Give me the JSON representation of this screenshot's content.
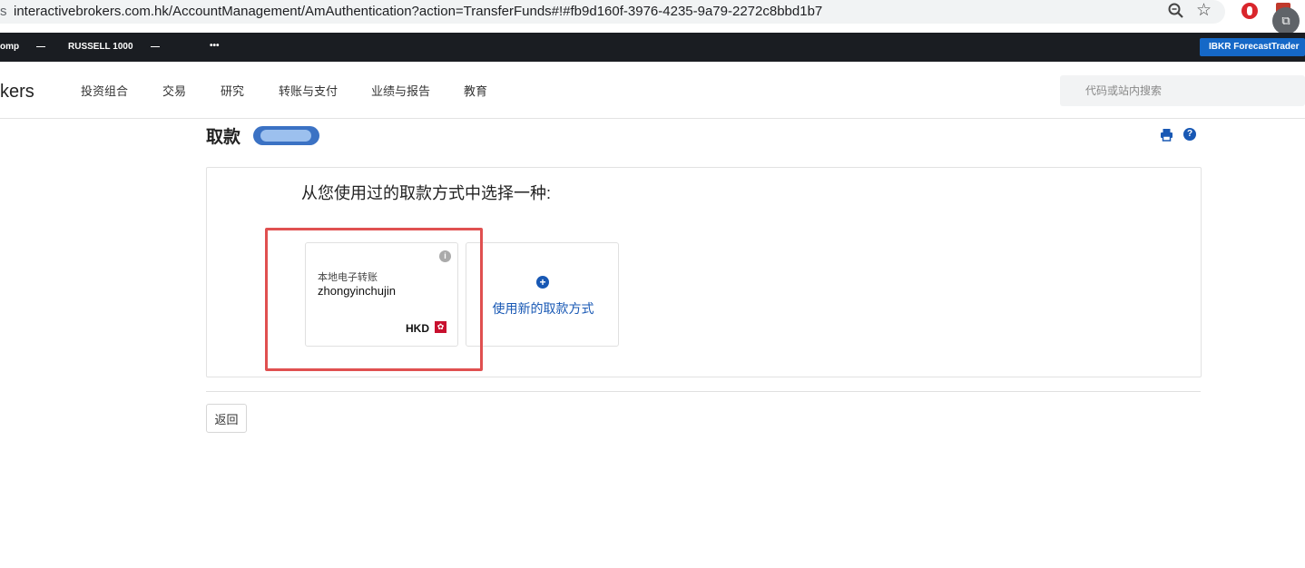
{
  "browser": {
    "url": "interactivebrokers.com.hk/AccountManagement/AmAuthentication?action=TransferFunds#!#fb9d160f-3976-4235-9a79-2272c8bbd1b7",
    "lead_char": "s"
  },
  "ticker": {
    "items": [
      "omp",
      "—",
      "RUSSELL 1000",
      "—",
      "•••"
    ],
    "forecast_label": "IBKR ForecastTrader"
  },
  "nav": {
    "brand": "kers",
    "items": [
      "投资组合",
      "交易",
      "研究",
      "转账与支付",
      "业绩与报告",
      "教育"
    ],
    "search_placeholder": "代码或站内搜索"
  },
  "page": {
    "title": "取款",
    "prompt": "从您使用过的取款方式中选择一种:"
  },
  "methods": {
    "existing": {
      "type": "本地电子转账",
      "name": "zhongyinchujin",
      "currency": "HKD",
      "flag_icon": "hk-flag-icon"
    },
    "new_method_label": "使用新的取款方式"
  },
  "buttons": {
    "back": "返回"
  },
  "colors": {
    "accent": "#1858b4",
    "highlight": "#e05050",
    "ticker_bg": "#1a1d22",
    "forecast_bg": "#1568c7"
  }
}
